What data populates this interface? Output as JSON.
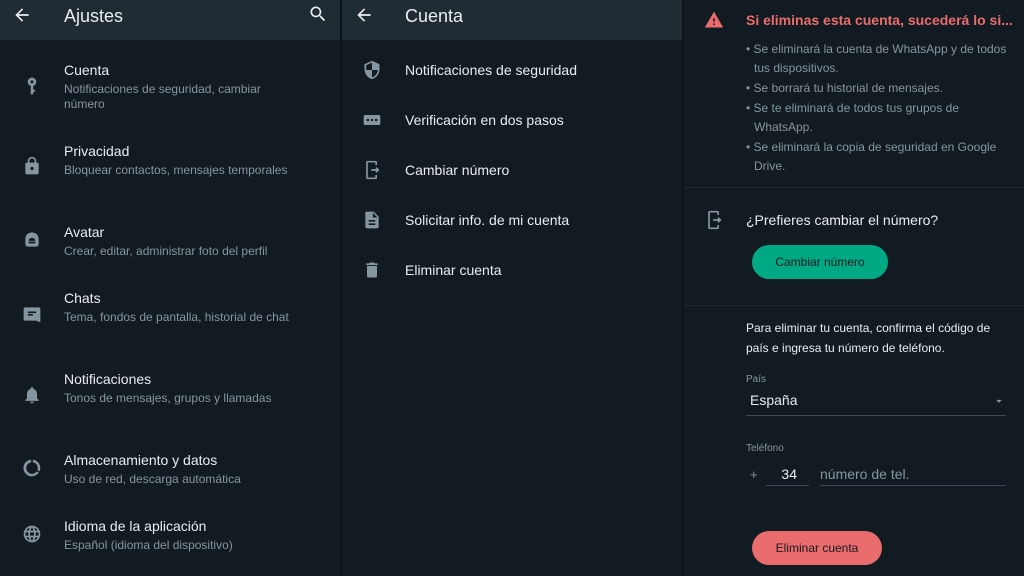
{
  "settings": {
    "title": "Ajustes",
    "items": [
      {
        "title": "Cuenta",
        "subtitle": "Notificaciones de seguridad, cambiar número",
        "icon": "key-icon"
      },
      {
        "title": "Privacidad",
        "subtitle": "Bloquear contactos, mensajes temporales",
        "icon": "lock-icon"
      },
      {
        "title": "Avatar",
        "subtitle": "Crear, editar, administrar foto del perfil",
        "icon": "avatar-icon"
      },
      {
        "title": "Chats",
        "subtitle": "Tema, fondos de pantalla, historial de chat",
        "icon": "chat-icon"
      },
      {
        "title": "Notificaciones",
        "subtitle": "Tonos de mensajes, grupos y llamadas",
        "icon": "bell-icon"
      },
      {
        "title": "Almacenamiento y datos",
        "subtitle": "Uso de red, descarga automática",
        "icon": "storage-icon"
      },
      {
        "title": "Idioma de la aplicación",
        "subtitle": "Español (idioma del dispositivo)",
        "icon": "globe-icon"
      }
    ]
  },
  "account": {
    "title": "Cuenta",
    "items": [
      {
        "label": "Notificaciones de seguridad",
        "icon": "shield-icon"
      },
      {
        "label": "Verificación en dos pasos",
        "icon": "dots-icon"
      },
      {
        "label": "Cambiar número",
        "icon": "change-phone-icon"
      },
      {
        "label": "Solicitar info. de mi cuenta",
        "icon": "document-icon"
      },
      {
        "label": "Eliminar cuenta",
        "icon": "trash-icon"
      }
    ]
  },
  "delete": {
    "warning_title": "Si eliminas esta cuenta, sucederá lo si...",
    "bullets": [
      "• Se eliminará la cuenta de WhatsApp y de todos tus dispositivos.",
      "• Se borrará tu historial de mensajes.",
      "• Se te eliminará de todos tus grupos de WhatsApp.",
      "• Se eliminará la copia de seguridad en Google Drive."
    ],
    "prefer_text": "¿Prefieres cambiar el número?",
    "change_button": "Cambiar número",
    "confirm_text": "Para eliminar tu cuenta, confirma el código de país e ingresa tu número de teléfono.",
    "country_label": "País",
    "country_value": "España",
    "phone_label": "Teléfono",
    "plus": "+",
    "country_code": "34",
    "phone_placeholder": "número de tel.",
    "delete_button": "Eliminar cuenta"
  },
  "colors": {
    "accent_green": "#00a884",
    "danger_red": "#ea6c6c",
    "panel_bg": "#111b21",
    "header_bg": "#1f2c34"
  }
}
